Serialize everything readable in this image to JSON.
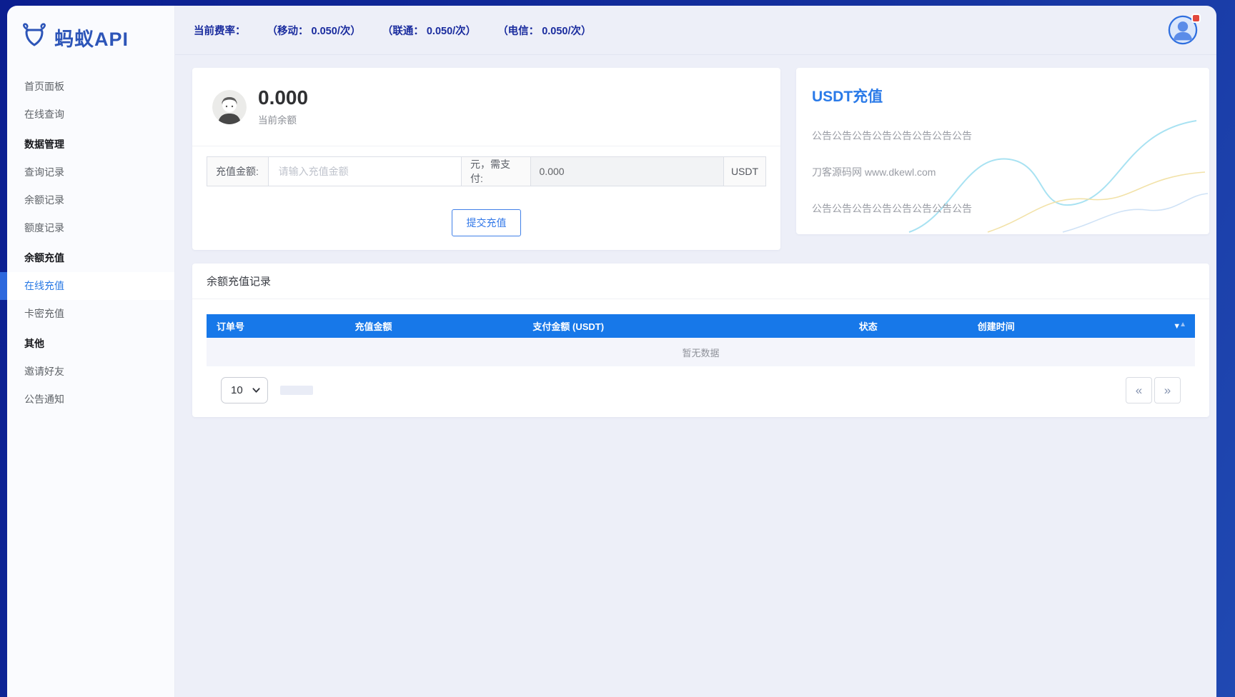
{
  "app": {
    "logo_text": "蚂蚁API"
  },
  "topbar": {
    "rate_label": "当前费率：",
    "rates": [
      {
        "text": "（移动： 0.050/次）"
      },
      {
        "text": "（联通： 0.050/次）"
      },
      {
        "text": "（电信： 0.050/次）"
      }
    ]
  },
  "sidebar": {
    "items": [
      {
        "label": "首页面板",
        "type": "link"
      },
      {
        "label": "在线查询",
        "type": "link"
      },
      {
        "label": "数据管理",
        "type": "section"
      },
      {
        "label": "查询记录",
        "type": "link"
      },
      {
        "label": "余额记录",
        "type": "link"
      },
      {
        "label": "额度记录",
        "type": "link"
      },
      {
        "label": "余额充值",
        "type": "section"
      },
      {
        "label": "在线充值",
        "type": "link",
        "active": true
      },
      {
        "label": "卡密充值",
        "type": "link"
      },
      {
        "label": "其他",
        "type": "section"
      },
      {
        "label": "邀请好友",
        "type": "link"
      },
      {
        "label": "公告通知",
        "type": "link"
      }
    ]
  },
  "balance": {
    "amount": "0.000",
    "label": "当前余额"
  },
  "recharge_form": {
    "amount_label": "充值金额:",
    "amount_placeholder": "请输入充值金额",
    "pay_label": "元，需支付:",
    "pay_value": "0.000",
    "currency": "USDT",
    "submit_label": "提交充值"
  },
  "usdt_panel": {
    "title": "USDT充值",
    "lines": [
      {
        "text": "公告公告公告公告公告公告公告公告"
      },
      {
        "text": "刀客源码网 www.dkewl.com"
      },
      {
        "text": "公告公告公告公告公告公告公告公告"
      }
    ]
  },
  "records": {
    "title": "余额充值记录",
    "columns": [
      {
        "label": "订单号"
      },
      {
        "label": "充值金额"
      },
      {
        "label": "支付金额 (USDT)"
      },
      {
        "label": "状态"
      },
      {
        "label": "创建时间"
      }
    ],
    "rows": [],
    "empty_text": "暂无数据",
    "pager": {
      "page_size": "10",
      "prev": "«",
      "next": "»"
    }
  },
  "colors": {
    "frame_navy": "#14309e",
    "accent_blue": "#2a7ae8",
    "table_header_blue": "#1778e9",
    "active_nav_bar": "#2d68dd",
    "notification_red": "#e2483d",
    "wave_cyan": "#a8e2f2",
    "wave_yellow": "#f2e2a8",
    "wave_blue": "#cfe2f6"
  }
}
